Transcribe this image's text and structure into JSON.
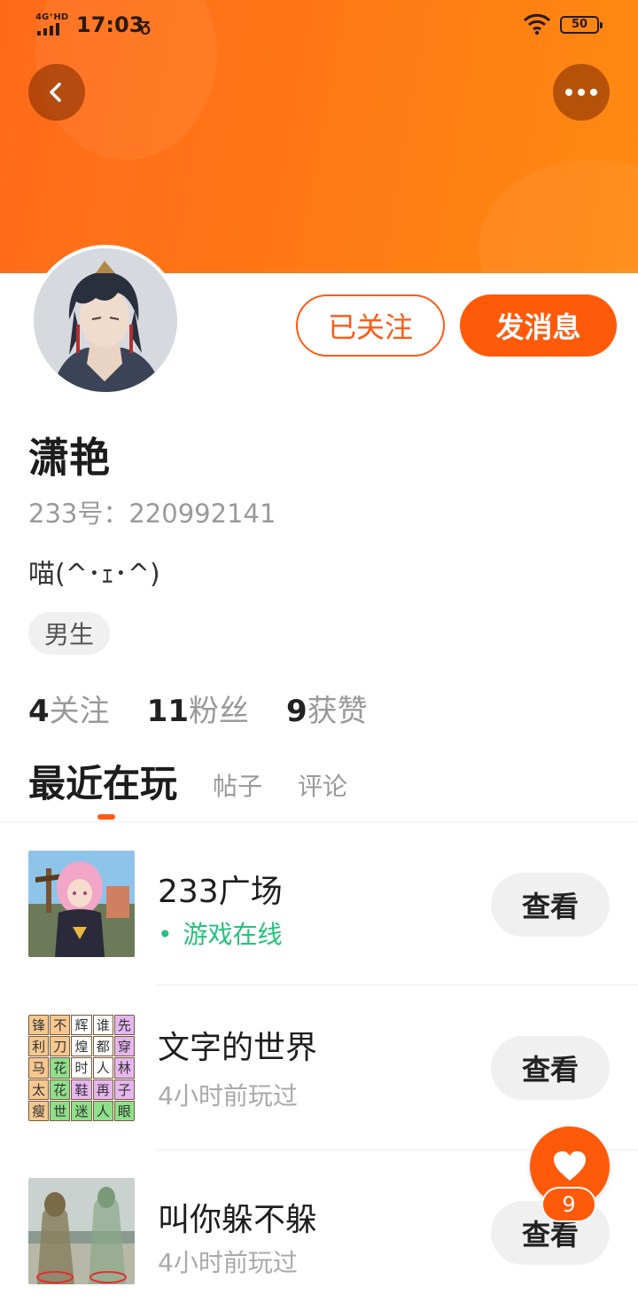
{
  "status_bar": {
    "network": "4G⁺HD",
    "time": "17:03",
    "extra_icon": "ᵹ",
    "battery": "50",
    "icons": [
      "signal-icon",
      "wifi-icon",
      "battery-icon"
    ]
  },
  "header": {
    "back_icon": "chevron-left-icon",
    "more_icon": "more-dots-icon",
    "colors": {
      "gradient_start": "#ff6a1a",
      "gradient_end": "#ff8a12"
    }
  },
  "profile": {
    "username": "潇艳",
    "user_id": "233号：220992141",
    "bio": "喵(^･ｪ･^)",
    "gender_tag": "男生",
    "follow_button": "已关注",
    "message_button": "发消息"
  },
  "stats": [
    {
      "count": "4",
      "label": "关注"
    },
    {
      "count": "11",
      "label": "粉丝"
    },
    {
      "count": "9",
      "label": "获赞"
    }
  ],
  "tabs": [
    {
      "label": "最近在玩",
      "active": true
    },
    {
      "label": "帖子",
      "active": false
    },
    {
      "label": "评论",
      "active": false
    }
  ],
  "games": [
    {
      "name": "233广场",
      "status": "游戏在线",
      "online": true,
      "button": "查看"
    },
    {
      "name": "文字的世界",
      "status": "4小时前玩过",
      "online": false,
      "button": "查看"
    },
    {
      "name": "叫你躲不躲",
      "status": "4小时前玩过",
      "online": false,
      "button": "查看"
    }
  ],
  "word_grid": [
    "锋",
    "不",
    "辉",
    "谁",
    "先",
    "利",
    "刀",
    "煌",
    "都",
    "穿",
    "马",
    "花",
    "时",
    "人",
    "林",
    "太",
    "花",
    "鞋",
    "再",
    "子",
    "瘦",
    "世",
    "迷",
    "人",
    "眼"
  ],
  "like_fab": {
    "count": "9",
    "icon": "heart-icon"
  },
  "accent_color": "#ff5a14",
  "online_color": "#23c27a"
}
